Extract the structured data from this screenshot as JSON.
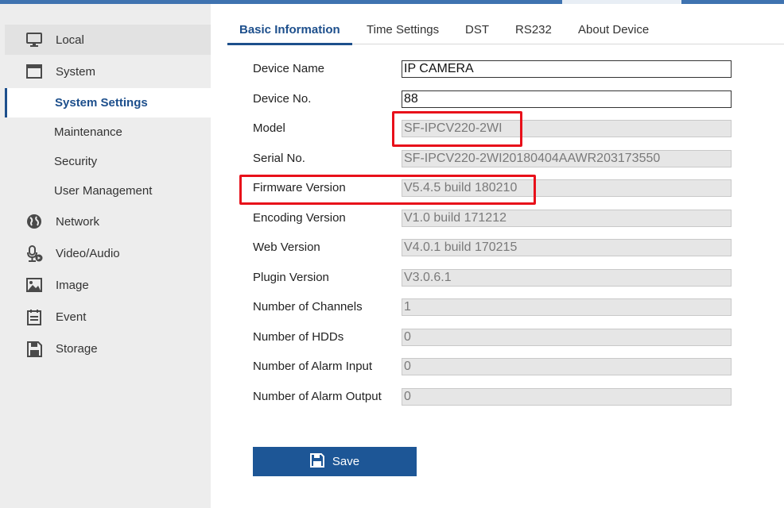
{
  "sidebar": {
    "items": [
      {
        "label": "Local",
        "icon": "monitor-icon"
      },
      {
        "label": "System",
        "icon": "window-icon"
      },
      {
        "label": "System Settings"
      },
      {
        "label": "Maintenance"
      },
      {
        "label": "Security"
      },
      {
        "label": "User Management"
      },
      {
        "label": "Network",
        "icon": "globe-icon"
      },
      {
        "label": "Video/Audio",
        "icon": "microphone-icon"
      },
      {
        "label": "Image",
        "icon": "image-icon"
      },
      {
        "label": "Event",
        "icon": "calendar-icon"
      },
      {
        "label": "Storage",
        "icon": "storage-icon"
      }
    ]
  },
  "tabs": [
    {
      "label": "Basic Information"
    },
    {
      "label": "Time Settings"
    },
    {
      "label": "DST"
    },
    {
      "label": "RS232"
    },
    {
      "label": "About Device"
    }
  ],
  "form": {
    "rows": [
      {
        "label": "Device Name",
        "value": "IP CAMERA"
      },
      {
        "label": "Device No.",
        "value": "88"
      },
      {
        "label": "Model",
        "value": "SF-IPCV220-2WI"
      },
      {
        "label": "Serial No.",
        "value": "SF-IPCV220-2WI20180404AAWR203173550"
      },
      {
        "label": "Firmware Version",
        "value": "V5.4.5 build 180210"
      },
      {
        "label": "Encoding Version",
        "value": "V1.0 build 171212"
      },
      {
        "label": "Web Version",
        "value": "V4.0.1 build 170215"
      },
      {
        "label": "Plugin Version",
        "value": "V3.0.6.1"
      },
      {
        "label": "Number of Channels",
        "value": "1"
      },
      {
        "label": "Number of HDDs",
        "value": "0"
      },
      {
        "label": "Number of Alarm Input",
        "value": "0"
      },
      {
        "label": "Number of Alarm Output",
        "value": "0"
      }
    ]
  },
  "save_label": "Save",
  "colors": {
    "accent": "#1d4f8c",
    "button": "#1d5696",
    "highlight": "#e8101a"
  }
}
